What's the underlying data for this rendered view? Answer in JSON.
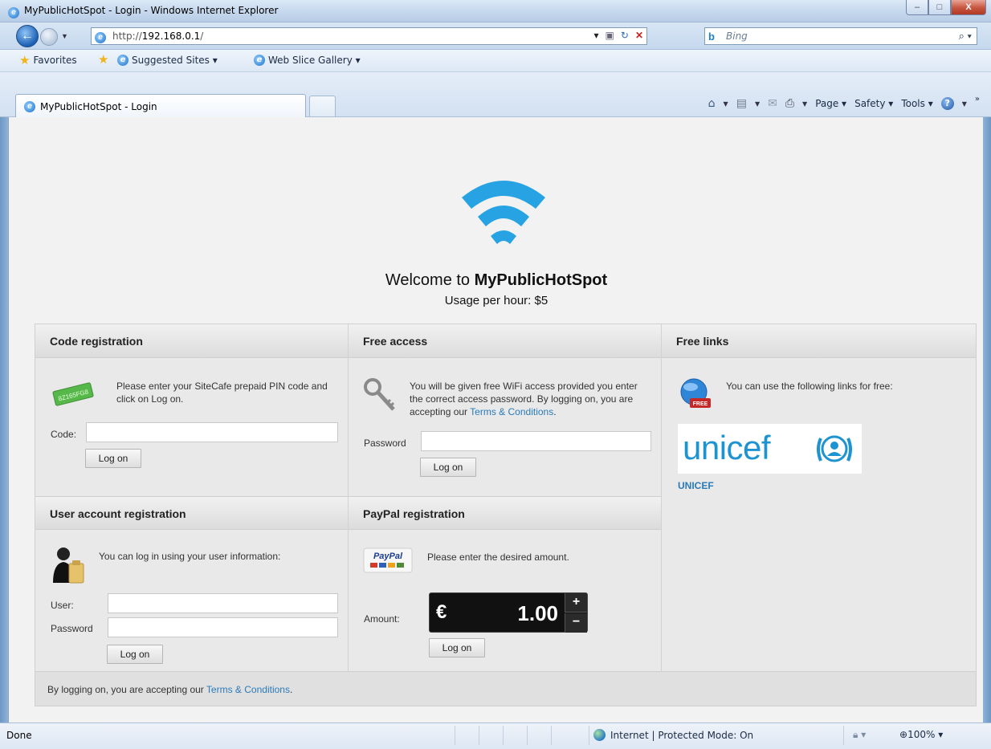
{
  "window": {
    "title": "MyPublicHotSpot - Login - Windows Internet Explorer",
    "minimize_glyph": "–",
    "maximize_glyph": "□",
    "close_glyph": "X"
  },
  "address_bar": {
    "url_prefix": "http://",
    "url_host": "192.168.0.1",
    "url_suffix": "/",
    "search_placeholder": "Bing"
  },
  "favorites_bar": {
    "favorites_label": "Favorites",
    "suggested_sites_label": "Suggested Sites ▾",
    "web_slice_gallery_label": "Web Slice Gallery ▾"
  },
  "tabs": [
    {
      "label": "MyPublicHotSpot - Login",
      "active": true
    }
  ],
  "command_bar": {
    "page_label": "Page ▾",
    "safety_label": "Safety ▾",
    "tools_label": "Tools ▾",
    "overflow_glyph": "»"
  },
  "page": {
    "welcome_prefix": "Welcome to ",
    "welcome_name": "MyPublicHotSpot",
    "usage": "Usage per hour: $5",
    "code_registration": {
      "title": "Code registration",
      "description": "Please enter your SiteCafe prepaid PIN code and click on Log on.",
      "pin_badge": "8Z165FG8",
      "code_label": "Code:",
      "code_value": "",
      "button": "Log on"
    },
    "free_access": {
      "title": "Free access",
      "description": "You will be given free WiFi access provided you enter the correct access password. By logging on, you are accepting our ",
      "terms_link": "Terms & Conditions",
      "description_end": ".",
      "password_label": "Password",
      "password_value": "",
      "button": "Log on"
    },
    "free_links": {
      "title": "Free links",
      "description": "You can use the following links for free:",
      "free_badge": "FREE",
      "unicef_logo_text": "unicef",
      "unicef_link": "UNICEF"
    },
    "user_account": {
      "title": "User account registration",
      "description": "You can log in using your user information:",
      "user_label": "User:",
      "user_value": "",
      "password_label": "Password",
      "password_value": "",
      "button": "Log on"
    },
    "paypal": {
      "title": "PayPal registration",
      "description": "Please enter the desired amount.",
      "logo_text": "PayPal",
      "amount_label": "Amount:",
      "currency": "€",
      "amount_value": "1.00",
      "plus": "+",
      "minus": "−",
      "button": "Log on"
    },
    "footer": {
      "text": "By logging on, you are accepting our ",
      "terms_link": "Terms & Conditions",
      "text_end": "."
    }
  },
  "status_bar": {
    "status": "Done",
    "zone": "Internet | Protected Mode: On",
    "zoom": "100%"
  },
  "colors": {
    "accent": "#2a7ab8",
    "wifi_blue": "#27a3e3",
    "unicef_blue": "#1d93d2"
  }
}
